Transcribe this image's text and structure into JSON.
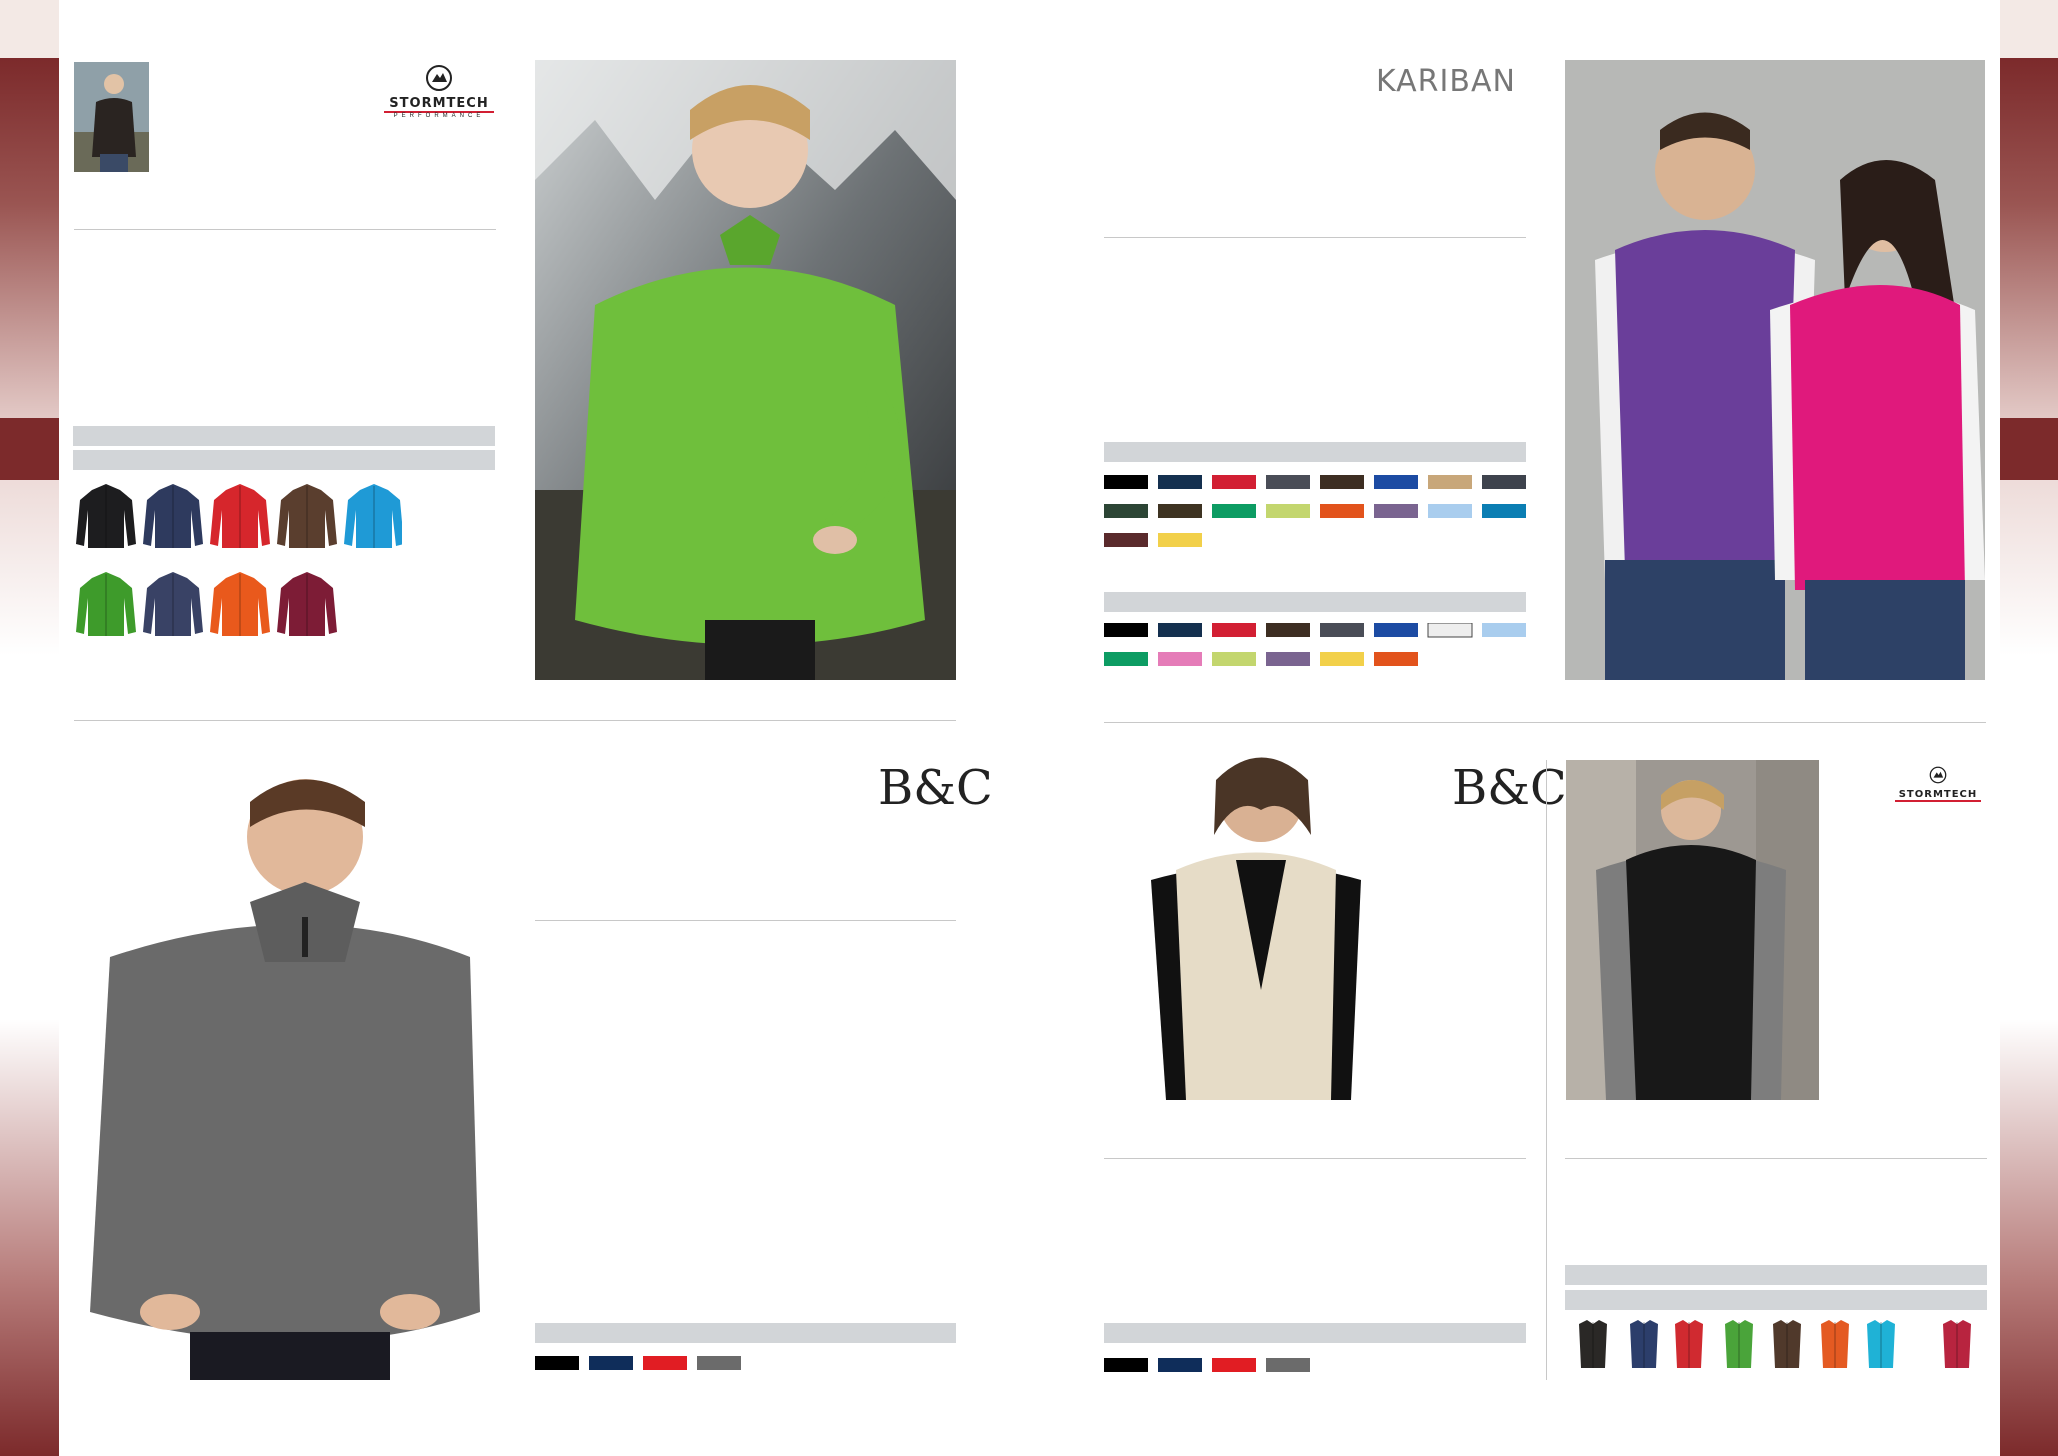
{
  "brands": {
    "stormtech": "STORMTECH",
    "stormtech_sub": "PERFORMANCE",
    "kariban": "KARIBAN",
    "bc": "B&C"
  },
  "colors": {
    "edge_maroon": "#7c2a2b",
    "divider_gray": "#c8c8c8",
    "label_bar_gray": "#d2d5d8"
  },
  "products": {
    "stormtech_pullover": {
      "jacket_swatches": [
        "#1d1d1f",
        "#2e3a5e",
        "#d6262c",
        "#5a3e2e",
        "#1f9ad6",
        "#3e9b2b",
        "#394265",
        "#e9591c",
        "#7d1c36"
      ]
    },
    "kariban_vests": {
      "men_swatches": [
        "#000000",
        "#14304f",
        "#d21f33",
        "#4a4d57",
        "#3d2e22",
        "#1c4ba3",
        "#c8a77a",
        "#3e434d",
        "#2c4535",
        "#3e3322",
        "#0d9c63",
        "#c3d66e",
        "#e2531c",
        "#7a6490",
        "#a9cdee",
        "#0b7eb3",
        "#5a2a2c",
        "#f2d04a"
      ],
      "women_swatches": [
        "#000000",
        "#14304f",
        "#d21f33",
        "#3d2e22",
        "#4a4d57",
        "#1c4ba3",
        "#eeeeee",
        "#a9cdee",
        "#0d9c63",
        "#e57cb8",
        "#c3d66e",
        "#7a6490",
        "#f2d04a",
        "#e2531c"
      ]
    },
    "bc_pullover": {
      "swatches": [
        "#000000",
        "#0f2d5a",
        "#e11d23",
        "#6b6b6b"
      ]
    },
    "bc_vest": {
      "swatches": [
        "#000000",
        "#0f2d5a",
        "#e11d23",
        "#6b6b6b"
      ]
    },
    "stormtech_vest": {
      "vest_swatches": [
        "#2a2826",
        "#2c3e6b",
        "#d02a30",
        "#4aa43a",
        "#50392b",
        "#e45a22",
        "#1fb2d6",
        "#b8243f"
      ]
    }
  }
}
